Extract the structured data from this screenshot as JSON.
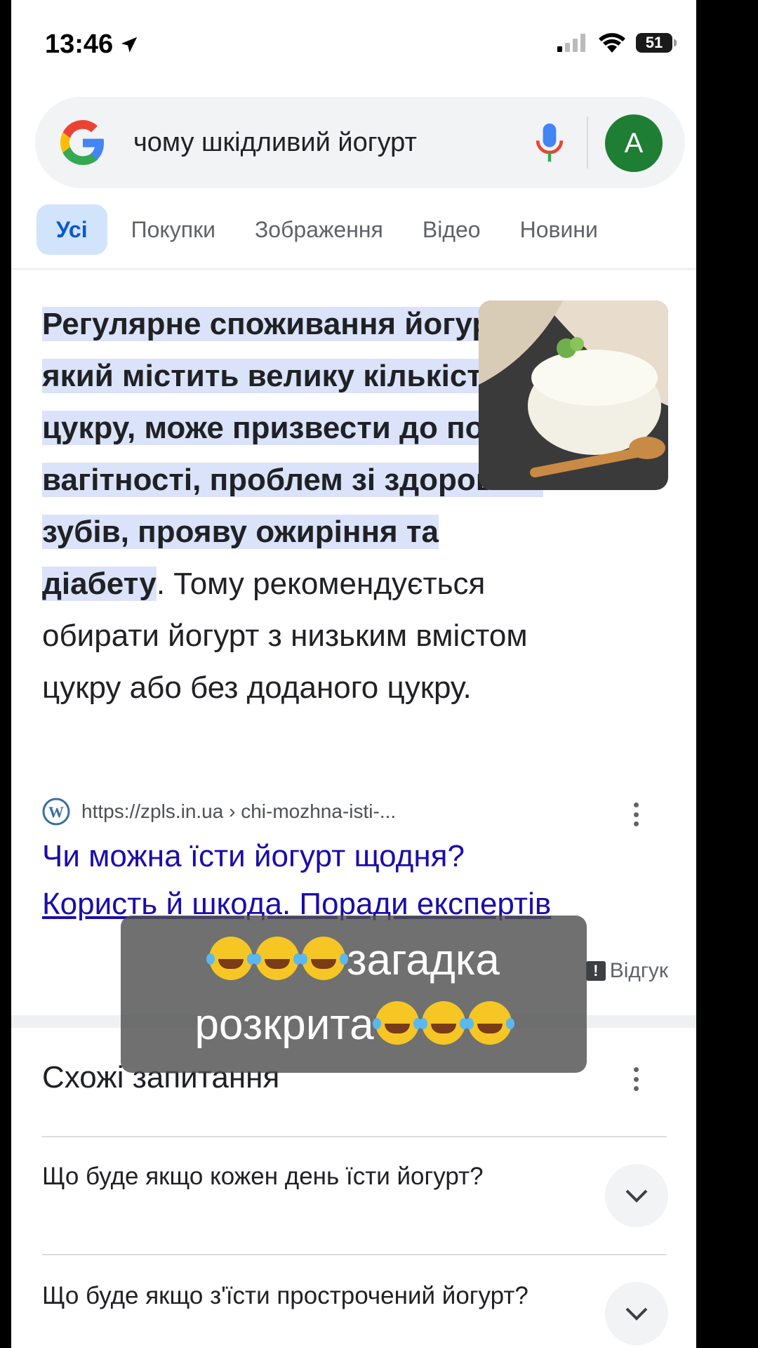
{
  "status": {
    "time": "13:46",
    "battery": "51"
  },
  "search": {
    "query": "чому шкідливий йогурт",
    "avatar_letter": "A"
  },
  "tabs": [
    {
      "label": "Усі",
      "active": true
    },
    {
      "label": "Покупки"
    },
    {
      "label": "Зображення"
    },
    {
      "label": "Відео"
    },
    {
      "label": "Новини"
    }
  ],
  "answer": {
    "highlighted": "Регулярне споживання йогурту, який містить велику кількість цукру, може призвести до появи вагітності, проблем зі здоров'ям зубів, прояву ожиріння та діабету",
    "rest": ". Тому рекомендується обирати йогурт з низьким вмістом цукру або без доданого цукру."
  },
  "source": {
    "url": "https://zpls.in.ua › chi-mozhna-isti-...",
    "title_line1": "Чи можна їсти йогурт щодня?",
    "title_line2": "Користь й шкода. Поради експертів",
    "feedback": "Відгук"
  },
  "overlay": {
    "line1": "загадка",
    "line2": "розкрита"
  },
  "related": {
    "title": "Схожі запитання",
    "questions": [
      "Що буде якщо кожен день їсти йогурт?",
      "Що буде якщо з'їсти прострочений йогурт?"
    ]
  },
  "colors": {
    "highlight": "#dbe3fb",
    "link": "#1a0dab",
    "avatar": "#1e7e34",
    "active_tab": "#d2e3fc"
  }
}
